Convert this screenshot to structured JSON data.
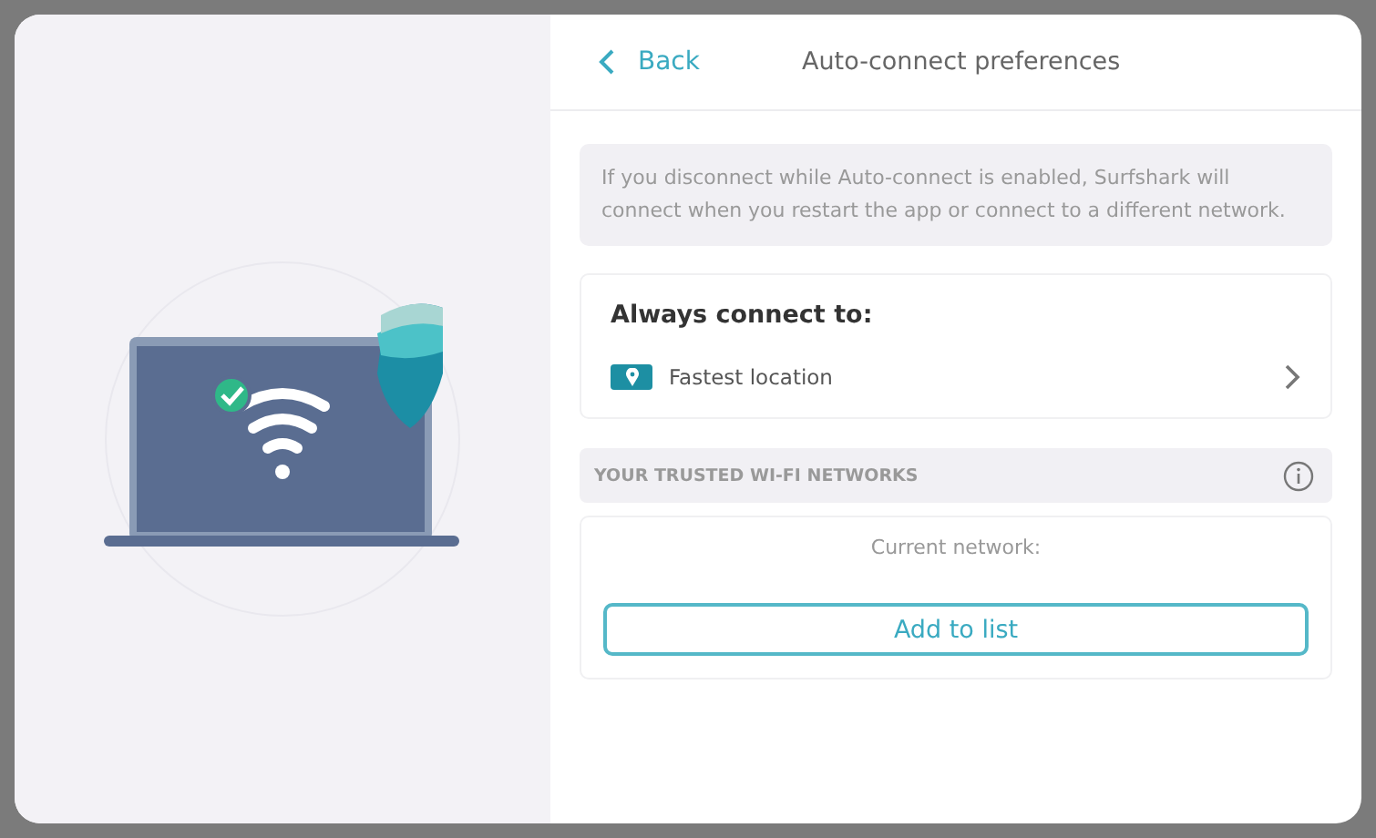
{
  "header": {
    "back_label": "Back",
    "title": "Auto-connect preferences"
  },
  "notice": "If you disconnect while Auto-connect is enabled, Surfshark will connect when you restart the app or connect to a different network.",
  "always_connect": {
    "heading": "Always connect to:",
    "location": "Fastest location"
  },
  "trusted_networks": {
    "heading": "YOUR TRUSTED WI-FI NETWORKS",
    "current_network_label": "Current network:",
    "add_button": "Add to list"
  }
}
